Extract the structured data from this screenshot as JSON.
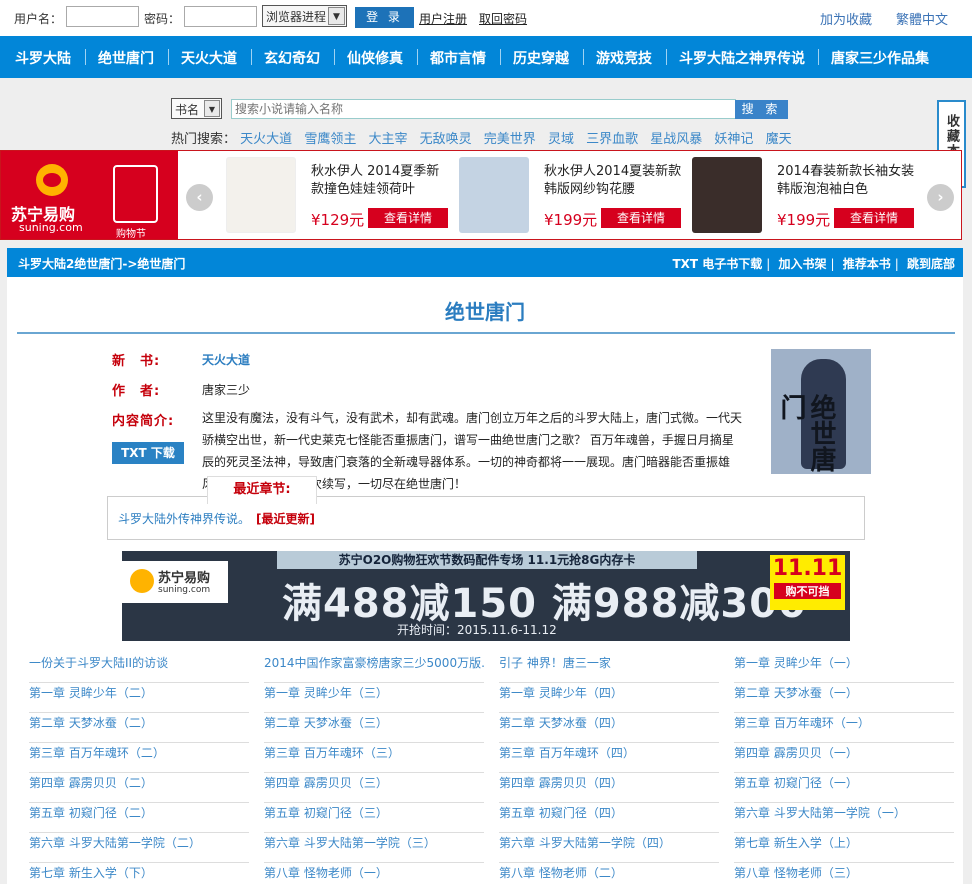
{
  "login": {
    "username_label": "用户名：",
    "password_label": "密码：",
    "select_value": "浏览器进程",
    "login_button": "登 录",
    "register_link": "用户注册",
    "recover_link": "取回密码",
    "favorite_link": "加为收藏",
    "traditional_link": "繁體中文"
  },
  "nav": [
    "斗罗大陆",
    "绝世唐门",
    "天火大道",
    "玄幻奇幻",
    "仙侠修真",
    "都市言情",
    "历史穿越",
    "游戏竞技",
    "斗罗大陆之神界传说",
    "唐家三少作品集"
  ],
  "search": {
    "category": "书名",
    "placeholder": "搜索小说请输入名称",
    "button": "搜 索",
    "hot_label": "热门搜索：",
    "hot": [
      "天火大道",
      "雪鹰领主",
      "大主宰",
      "无敌唤灵",
      "完美世界",
      "灵域",
      "三界血歌",
      "星战风暴",
      "妖神记",
      "魔天"
    ]
  },
  "side_fav": "收藏本站",
  "ad": {
    "brand": "苏宁易购",
    "brand_domain": "suning.com",
    "bag_text": "购物节",
    "prev": "‹",
    "next": "›",
    "products": [
      {
        "title": "秋水伊人 2014夏季新款撞色娃娃领荷叶",
        "price": "¥129元",
        "detail": "查看详情"
      },
      {
        "title": "秋水伊人2014夏装新款韩版网纱钩花腰",
        "price": "¥199元",
        "detail": "查看详情"
      },
      {
        "title": "2014春装新款长袖女装韩版泡泡袖白色",
        "price": "¥199元",
        "detail": "查看详情"
      }
    ]
  },
  "breadcrumb": "斗罗大陆2绝世唐门->绝世唐门",
  "tools": [
    "TXT 电子书下载",
    "加入书架",
    "推荐本书",
    "跳到底部"
  ],
  "book": {
    "title": "绝世唐门",
    "new_label": "新　书:",
    "new_value": "天火大道",
    "author_label": "作　者:",
    "author_value": "唐家三少",
    "intro_label": "内容简介:",
    "intro": "这里没有魔法，没有斗气，没有武术，却有武魂。唐门创立万年之后的斗罗大陆上，唐门式微。一代天骄横空出世，新一代史莱克七怪能否重振唐门，谱写一曲绝世唐门之歌？ 百万年魂兽，手握日月摘星辰的死灵圣法神，导致唐门衰落的全新魂导器体系。一切的神奇都将一一展现。唐门暗器能否重振雄风，龙王传说能否再次续写，一切尽在绝世唐门！",
    "txt_button": "TXT 下载",
    "latest_tab": "最近章节:",
    "latest_chapter": "斗罗大陆外传神界传说。",
    "latest_update": "[最近更新]"
  },
  "banner": {
    "top": "苏宁O2O购物狂欢节数码配件专场 11.1元抢8G内存卡",
    "brand": "苏宁易购",
    "brand_domain": "suning.com",
    "big": "满488减150  满988减300",
    "date": "开抢时间：2015.11.6-11.12",
    "tag_num": "11.11",
    "tag_word": "购不可挡"
  },
  "chapters": [
    "一份关于斗罗大陆II的访谈",
    "2014中国作家富豪榜唐家三少5000万版...",
    "引子 神界！唐三一家",
    "第一章 灵眸少年（一）",
    "第一章 灵眸少年（二）",
    "第一章 灵眸少年（三）",
    "第一章 灵眸少年（四）",
    "第二章 天梦冰蚕（一）",
    "第二章 天梦冰蚕（二）",
    "第二章 天梦冰蚕（三）",
    "第二章 天梦冰蚕（四）",
    "第三章 百万年魂环（一）",
    "第三章 百万年魂环（二）",
    "第三章 百万年魂环（三）",
    "第三章 百万年魂环（四）",
    "第四章 霹雳贝贝（一）",
    "第四章 霹雳贝贝（二）",
    "第四章 霹雳贝贝（三）",
    "第四章 霹雳贝贝（四）",
    "第五章 初窥门径（一）",
    "第五章 初窥门径（二）",
    "第五章 初窥门径（三）",
    "第五章 初窥门径（四）",
    "第六章 斗罗大陆第一学院（一）",
    "第六章 斗罗大陆第一学院（二）",
    "第六章 斗罗大陆第一学院（三）",
    "第六章 斗罗大陆第一学院（四）",
    "第七章 新生入学（上）",
    "第七章 新生入学（下）",
    "第八章 怪物老师（一）",
    "第八章 怪物老师（二）",
    "第八章 怪物老师（三）"
  ],
  "colors": {
    "nav_blue": "#0286d8",
    "link_blue": "#3c88c8",
    "label_red": "#c5000b",
    "ad_red": "#d6001e"
  }
}
